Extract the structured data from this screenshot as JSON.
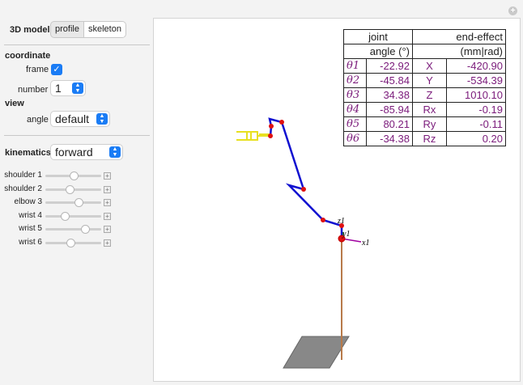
{
  "controls": {
    "model_label": "3D model",
    "model_options": [
      "profile",
      "skeleton"
    ],
    "model_selected": "skeleton",
    "coordinate_label": "coordinate",
    "frame_label": "frame",
    "frame_checked": true,
    "number_label": "number",
    "number_value": "1",
    "view_label": "view",
    "angle_label": "angle",
    "angle_value": "default",
    "kinematics_label": "kinematics",
    "kinematics_value": "forward",
    "sliders": [
      {
        "label": "shoulder 1",
        "position": 0.47
      },
      {
        "label": "shoulder 2",
        "position": 0.39
      },
      {
        "label": "elbow 3",
        "position": 0.57
      },
      {
        "label": "wrist 4",
        "position": 0.29
      },
      {
        "label": "wrist 5",
        "position": 0.68
      },
      {
        "label": "wrist 6",
        "position": 0.41
      }
    ]
  },
  "table": {
    "joint_header": "joint",
    "joint_unit": "angle (°)",
    "end_header": "end-effect",
    "end_unit": "(mm|rad)",
    "rows": [
      {
        "theta": "θ1",
        "angle": "-22.92",
        "coord": "X",
        "value": "-420.90"
      },
      {
        "theta": "θ2",
        "angle": "-45.84",
        "coord": "Y",
        "value": "-534.39"
      },
      {
        "theta": "θ3",
        "angle": "34.38",
        "coord": "Z",
        "value": "1010.10"
      },
      {
        "theta": "θ4",
        "angle": "-85.94",
        "coord": "Rx",
        "value": "-0.19"
      },
      {
        "theta": "θ5",
        "angle": "80.21",
        "coord": "Ry",
        "value": "-0.11"
      },
      {
        "theta": "θ6",
        "angle": "-34.38",
        "coord": "Rz",
        "value": "0.20"
      }
    ]
  },
  "axes_labels": {
    "z": "z1",
    "y": "y1",
    "x": "x1"
  },
  "colors": {
    "accent": "#1a7cf5",
    "arm": "#1010d0",
    "joint": "#e01010",
    "gripper": "#e8e020",
    "pole": "#b87a4a",
    "table_text": "#7a1a7a"
  }
}
